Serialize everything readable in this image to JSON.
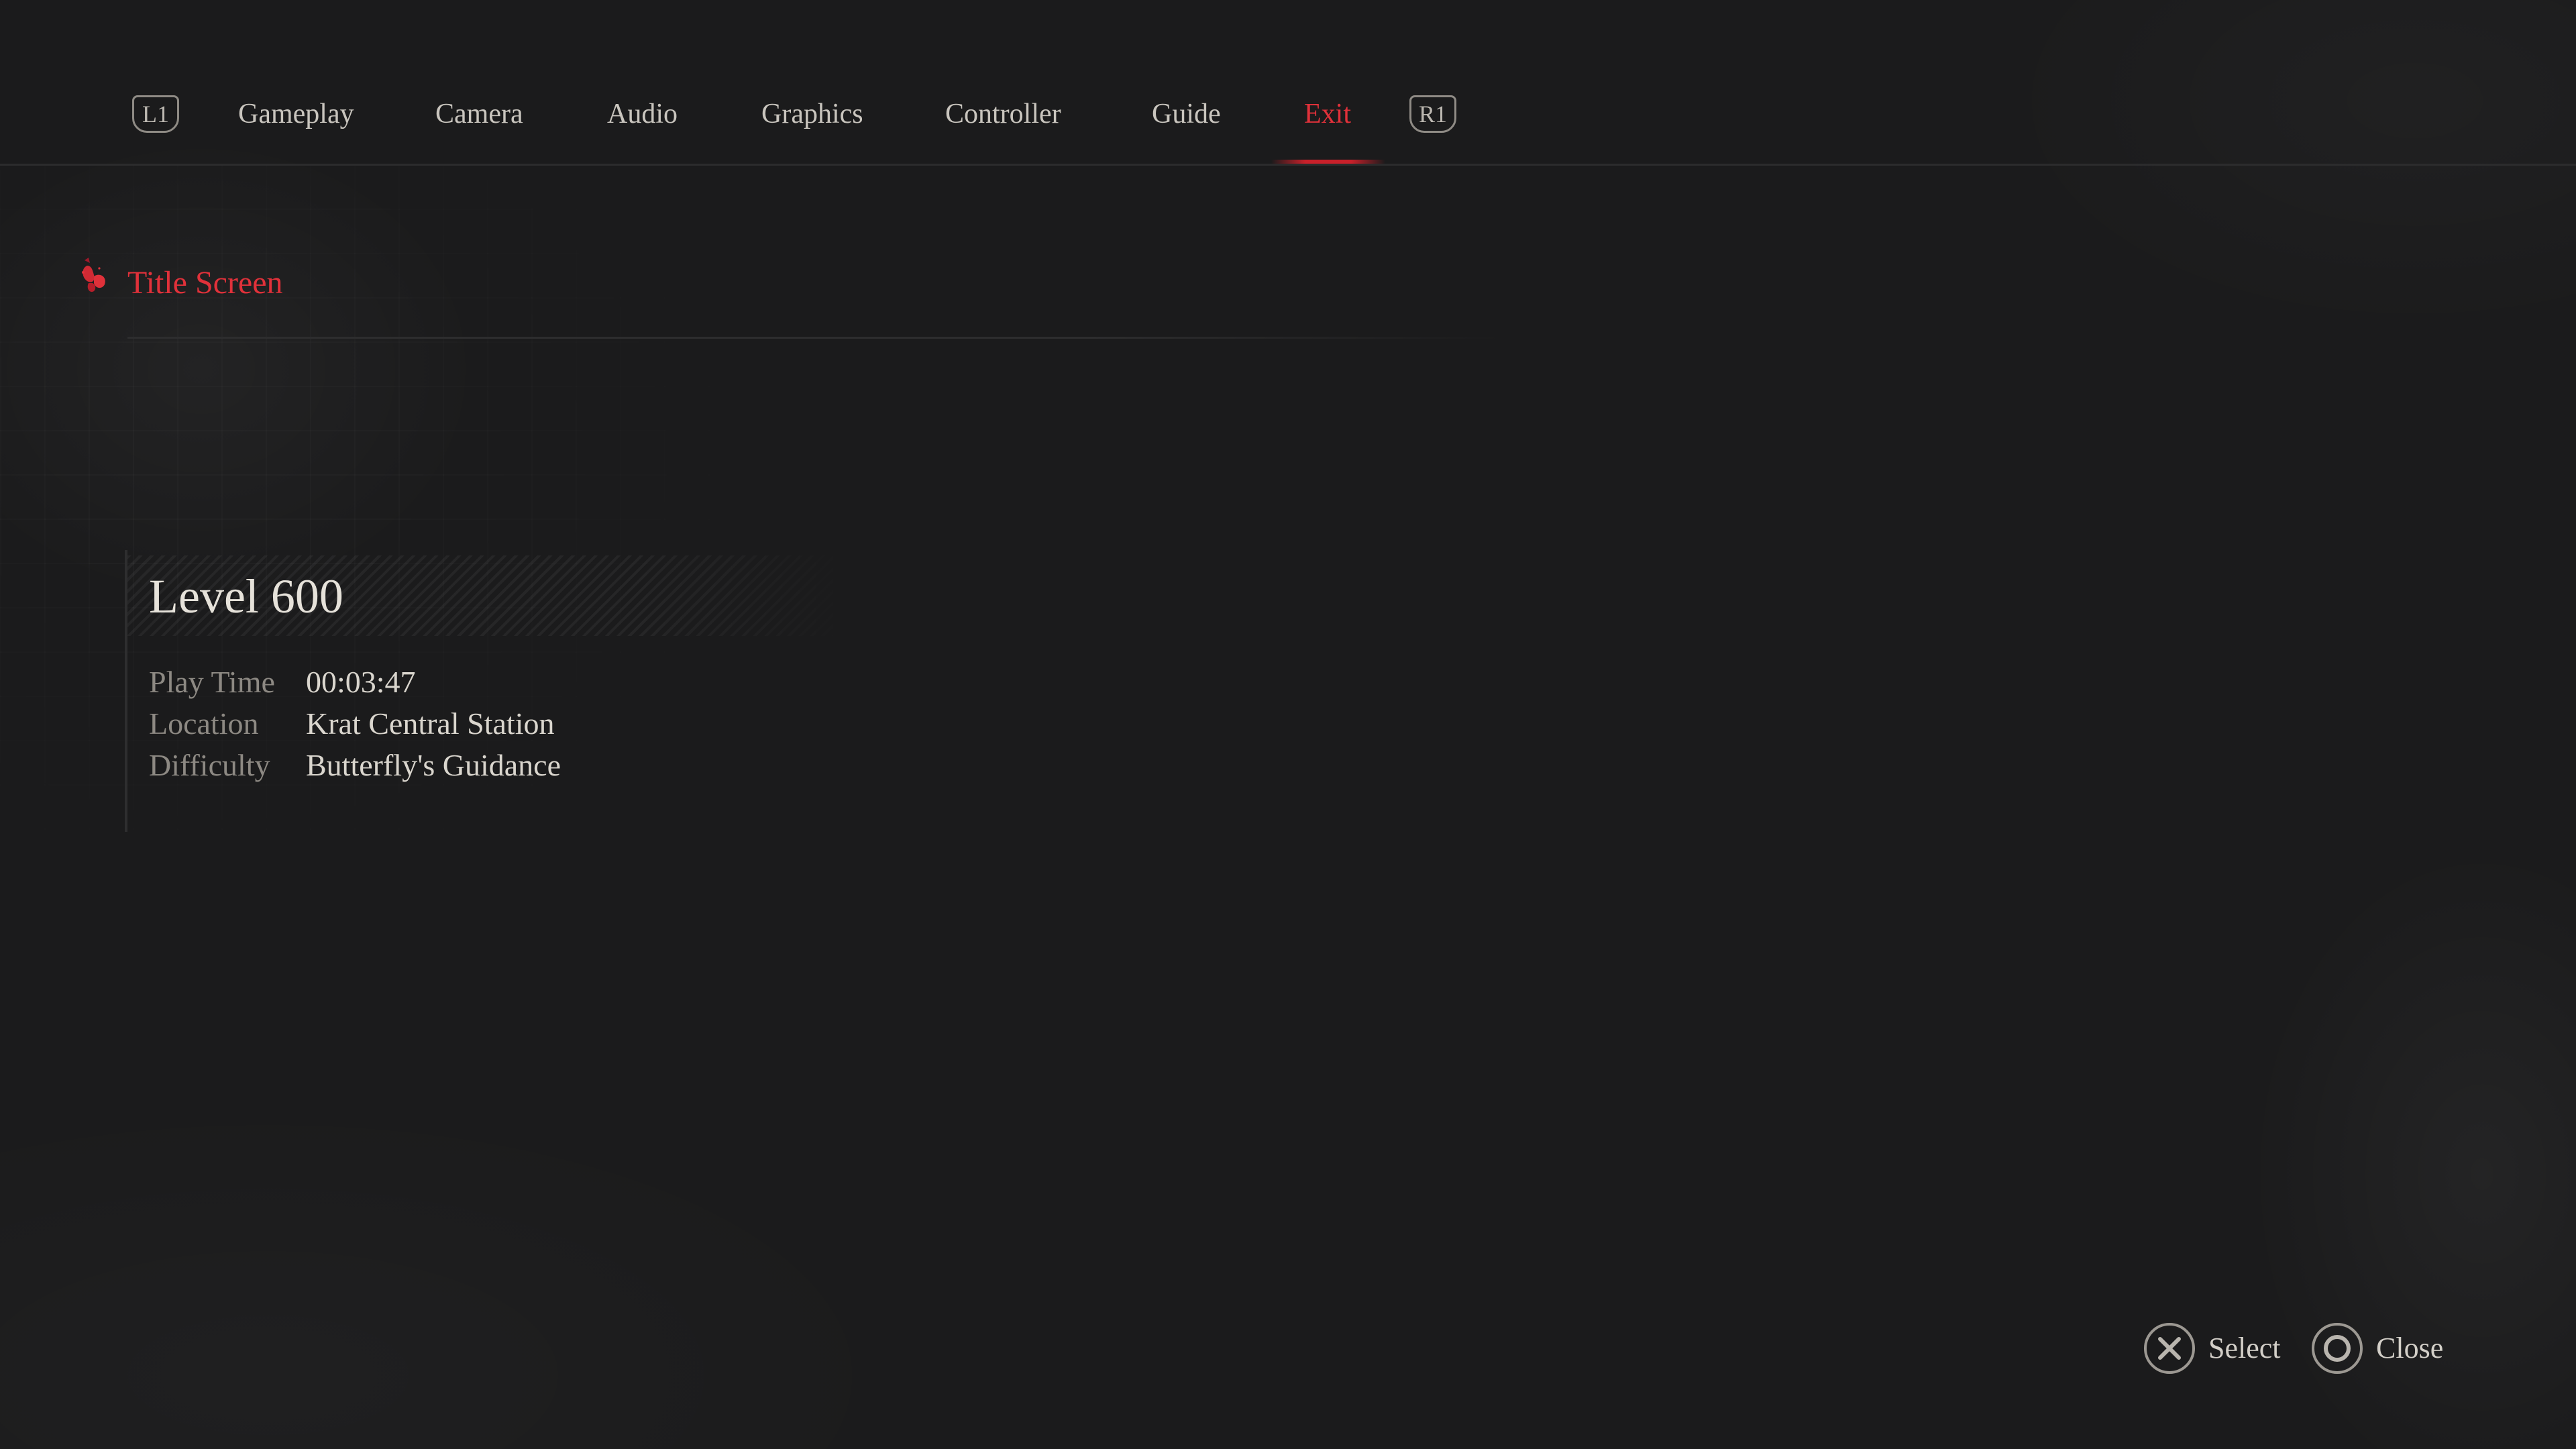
{
  "nav": {
    "left_shoulder": "L1",
    "right_shoulder": "R1",
    "tabs": [
      {
        "label": "Gameplay"
      },
      {
        "label": "Camera"
      },
      {
        "label": "Audio"
      },
      {
        "label": "Graphics"
      },
      {
        "label": "Controller"
      },
      {
        "label": "Guide"
      },
      {
        "label": "Exit"
      }
    ],
    "active_tab": "Exit"
  },
  "menu": {
    "items": [
      {
        "label": "Title Screen"
      }
    ]
  },
  "save": {
    "title": "Level 600",
    "rows": [
      {
        "label": "Play Time",
        "value": "00:03:47"
      },
      {
        "label": "Location",
        "value": "Krat Central Station"
      },
      {
        "label": "Difficulty",
        "value": "Butterfly's Guidance"
      }
    ]
  },
  "prompts": {
    "select": "Select",
    "close": "Close"
  },
  "colors": {
    "accent": "#e0313a",
    "background": "#1b1b1c",
    "text": "#d6d2cb",
    "muted": "#8d8983"
  },
  "icons": {
    "cursor": "butterfly-cursor-icon",
    "select": "cross-button-icon",
    "close": "circle-button-icon"
  }
}
